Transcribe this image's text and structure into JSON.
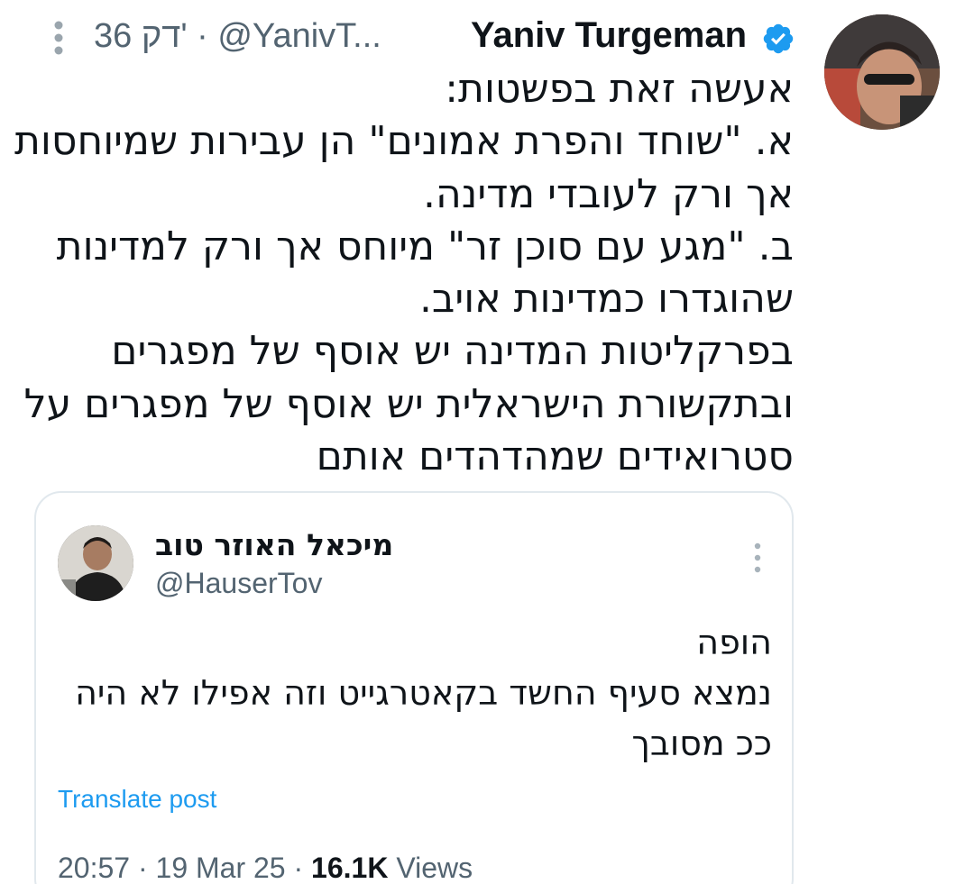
{
  "tweet": {
    "display_name": "Yaniv Turgeman",
    "handle_time": "36 דק' · @YanivT...",
    "verified_icon": "verified-badge-icon",
    "more_icon": "more-vertical-icon",
    "lines": [
      "אעשה זאת בפשטות:",
      "א. \"שוחד והפרת אמונים\" הן עבירות שמיוחסות",
      "אך ורק לעובדי מדינה.",
      "ב. \"מגע עם סוכן זר\" מיוחס אך ורק למדינות",
      "שהוגדרו כמדינות אויב.",
      "בפרקליטות המדינה יש אוסף של מפגרים",
      "ובתקשורת הישראלית יש אוסף של מפגרים על",
      "סטרואידים שמהדהדים אותם"
    ]
  },
  "quote": {
    "display_name": "מיכאל האוזר טוב",
    "handle": "@HauserTov",
    "more_icon": "more-vertical-icon",
    "lines": [
      "הופה",
      "נמצא סעיף החשד בקאטרגייט וזה אפילו לא היה",
      "ככ מסובך"
    ],
    "translate_label": "Translate post",
    "time": "20:57",
    "date": "19 Mar 25",
    "views_count": "16.1K",
    "views_label": "Views"
  },
  "colors": {
    "text": "#0f1419",
    "muted": "#536471",
    "link": "#1d9bf0",
    "verified": "#1d9bf0",
    "border": "#e1e8ed"
  }
}
